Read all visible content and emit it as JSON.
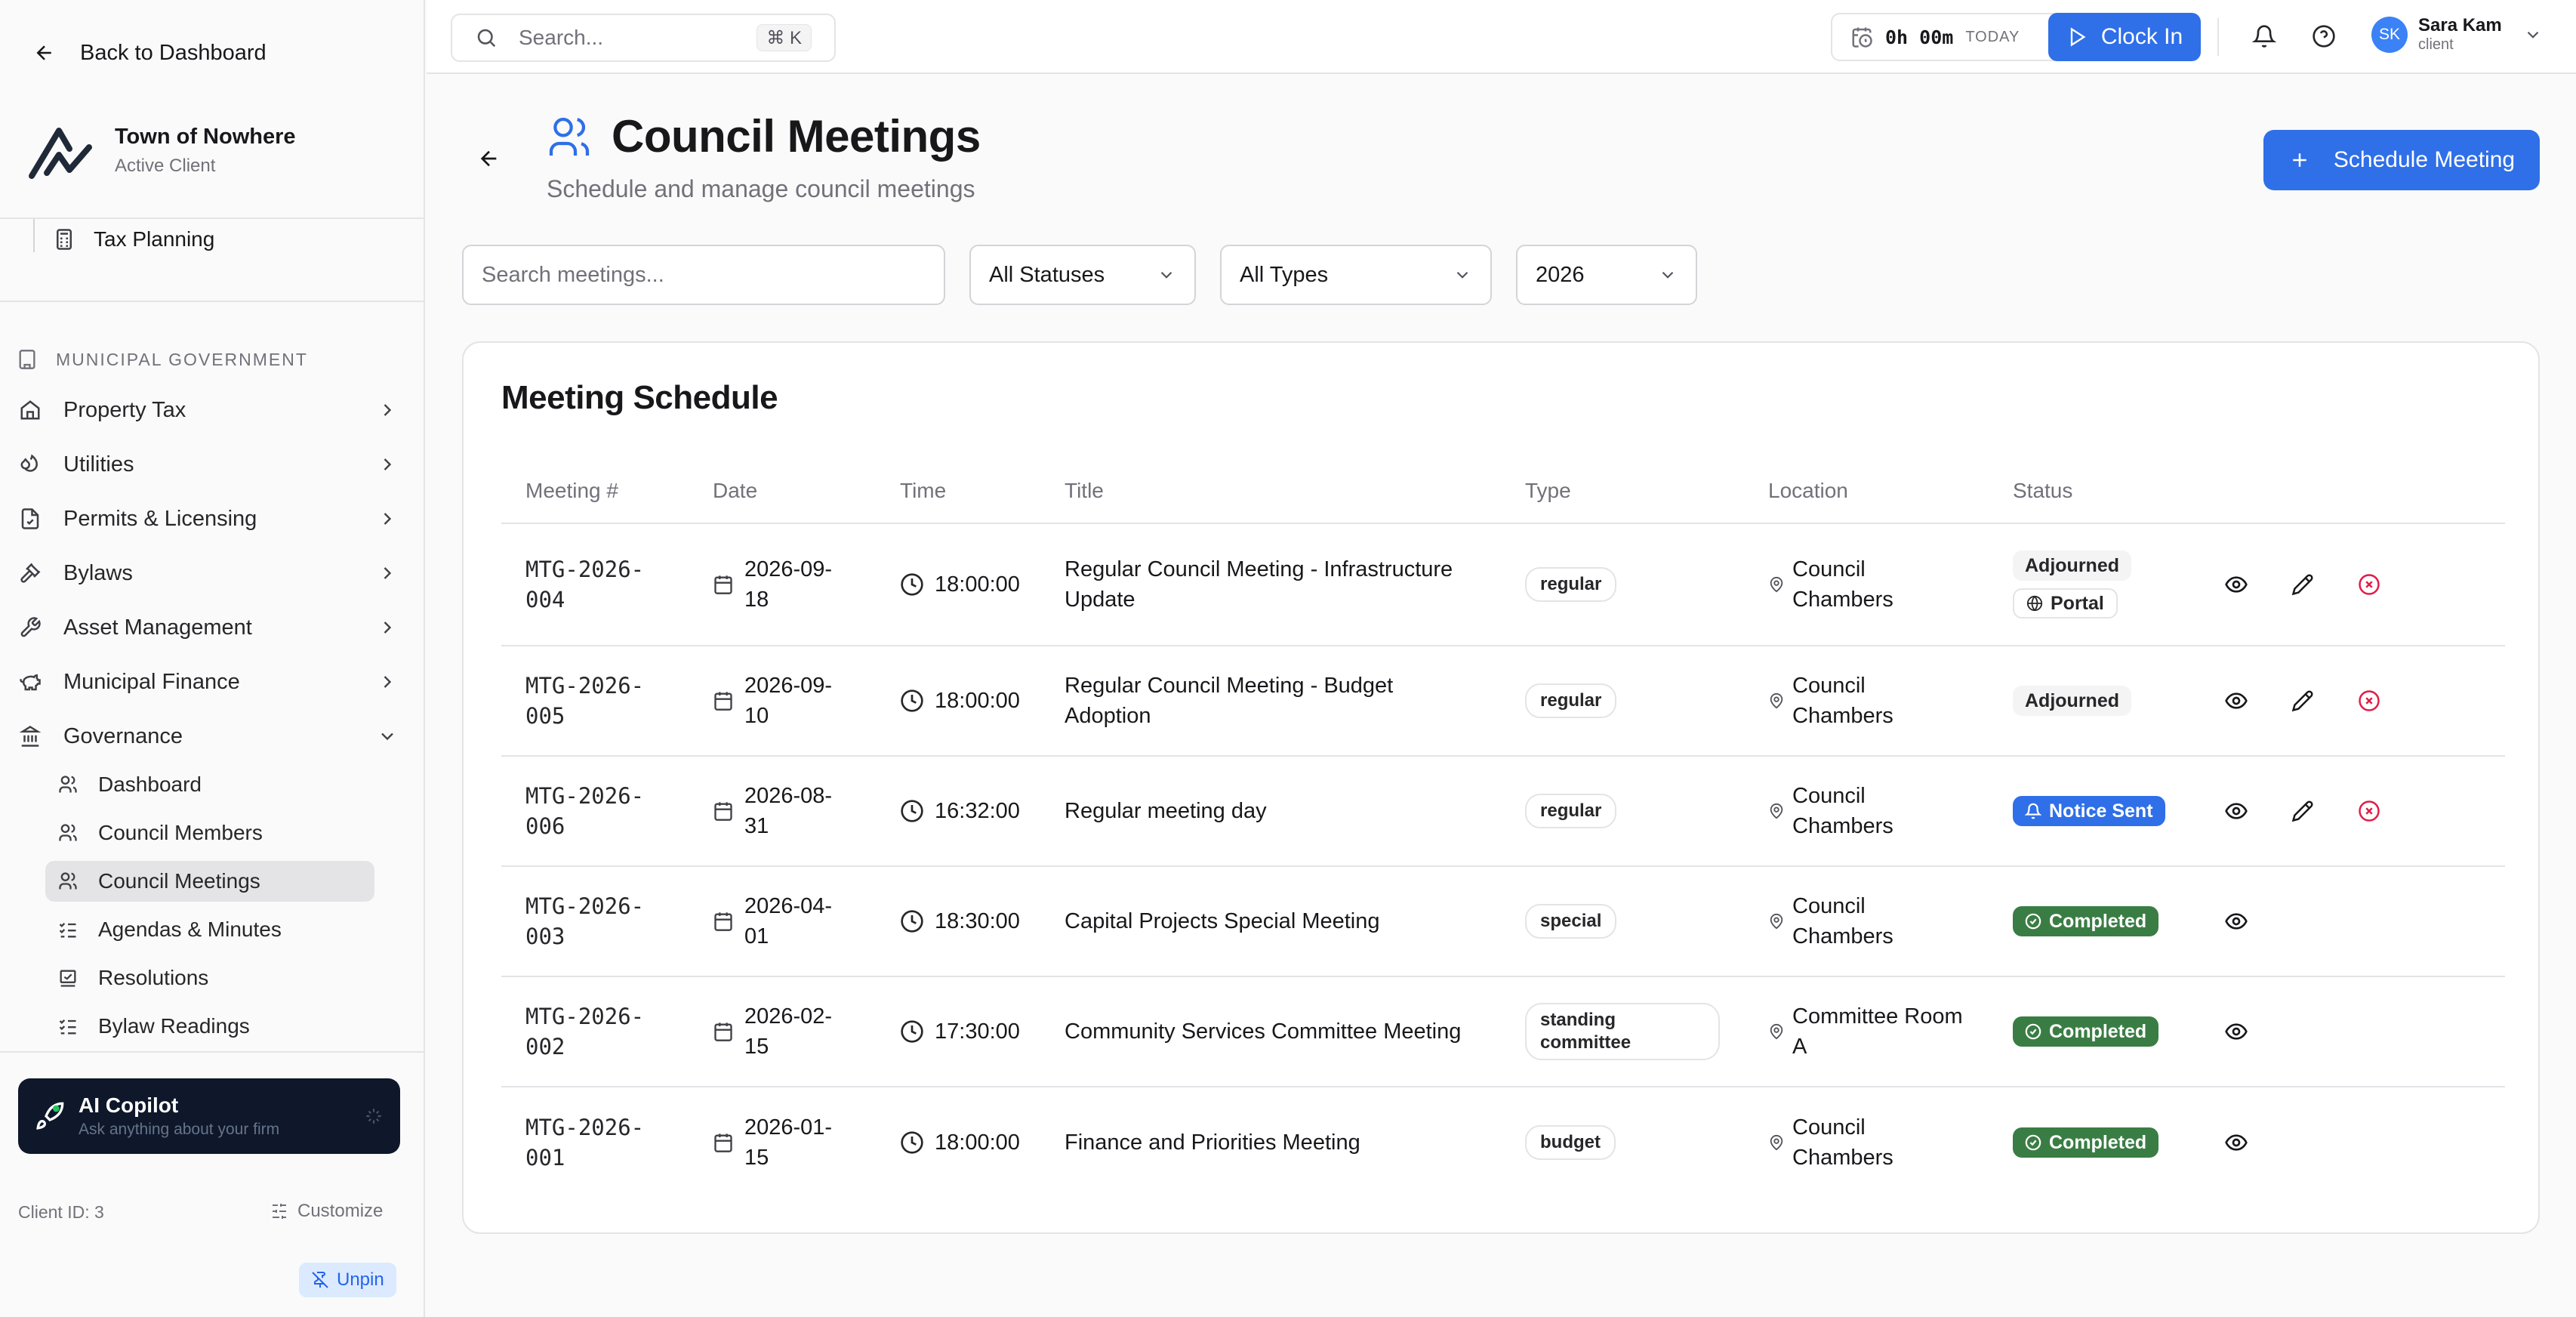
{
  "sidebar": {
    "back_label": "Back to Dashboard",
    "client_name": "Town of Nowhere",
    "client_status": "Active Client",
    "tax_planning": "Tax Planning",
    "section": "MUNICIPAL GOVERNMENT",
    "items": [
      {
        "label": "Property Tax",
        "icon": "home-icon"
      },
      {
        "label": "Utilities",
        "icon": "droplet-icon"
      },
      {
        "label": "Permits & Licensing",
        "icon": "file-check-icon"
      },
      {
        "label": "Bylaws",
        "icon": "gavel-icon"
      },
      {
        "label": "Asset Management",
        "icon": "wrench-icon"
      },
      {
        "label": "Municipal Finance",
        "icon": "piggy-bank-icon"
      },
      {
        "label": "Governance",
        "icon": "landmark-icon"
      }
    ],
    "sub_items": [
      {
        "label": "Dashboard",
        "icon": "users-icon"
      },
      {
        "label": "Council Members",
        "icon": "users-icon"
      },
      {
        "label": "Council Meetings",
        "icon": "users-icon"
      },
      {
        "label": "Agendas & Minutes",
        "icon": "list-checks-icon"
      },
      {
        "label": "Resolutions",
        "icon": "stamp-icon"
      },
      {
        "label": "Bylaw Readings",
        "icon": "list-checks-icon"
      }
    ],
    "copilot_title": "AI Copilot",
    "copilot_sub": "Ask anything about your firm",
    "client_id": "Client ID: 3",
    "customize": "Customize",
    "unpin": "Unpin"
  },
  "topbar": {
    "search_placeholder": "Search...",
    "kbd": "⌘ K",
    "timer": "0h 00m",
    "timer_label": "TODAY",
    "clock_in": "Clock In",
    "user_initials": "SK",
    "user_name": "Sara Kam",
    "user_role": "client"
  },
  "page": {
    "title": "Council Meetings",
    "subtitle": "Schedule and manage council meetings",
    "schedule_button": "Schedule Meeting"
  },
  "filters": {
    "search_placeholder": "Search meetings...",
    "status": "All Statuses",
    "type": "All Types",
    "year": "2026"
  },
  "table": {
    "title": "Meeting Schedule",
    "headers": [
      "Meeting #",
      "Date",
      "Time",
      "Title",
      "Type",
      "Location",
      "Status"
    ],
    "rows": [
      {
        "num1": "MTG-2026-",
        "num2": "004",
        "date1": "2026-09-",
        "date2": "18",
        "time": "18:00:00",
        "title1": "Regular Council Meeting - Infrastructure",
        "title2": "Update",
        "type1": "regular",
        "type2": "",
        "loc1": "Council",
        "loc2": "Chambers",
        "status": "Adjourned",
        "status2": "Portal",
        "edit": true
      },
      {
        "num1": "MTG-2026-",
        "num2": "005",
        "date1": "2026-09-",
        "date2": "10",
        "time": "18:00:00",
        "title1": "Regular Council Meeting - Budget",
        "title2": "Adoption",
        "type1": "regular",
        "type2": "",
        "loc1": "Council",
        "loc2": "Chambers",
        "status": "Adjourned",
        "status2": "",
        "edit": true
      },
      {
        "num1": "MTG-2026-",
        "num2": "006",
        "date1": "2026-08-",
        "date2": "31",
        "time": "16:32:00",
        "title1": "Regular meeting day",
        "title2": "",
        "type1": "regular",
        "type2": "",
        "loc1": "Council",
        "loc2": "Chambers",
        "status": "Notice Sent",
        "status2": "",
        "edit": true
      },
      {
        "num1": "MTG-2026-",
        "num2": "003",
        "date1": "2026-04-",
        "date2": "01",
        "time": "18:30:00",
        "title1": "Capital Projects Special Meeting",
        "title2": "",
        "type1": "special",
        "type2": "",
        "loc1": "Council",
        "loc2": "Chambers",
        "status": "Completed",
        "status2": "",
        "edit": false
      },
      {
        "num1": "MTG-2026-",
        "num2": "002",
        "date1": "2026-02-",
        "date2": "15",
        "time": "17:30:00",
        "title1": "Community Services Committee Meeting",
        "title2": "",
        "type1": "standing",
        "type2": "committee",
        "loc1": "Committee Room",
        "loc2": "A",
        "status": "Completed",
        "status2": "",
        "edit": false
      },
      {
        "num1": "MTG-2026-",
        "num2": "001",
        "date1": "2026-01-",
        "date2": "15",
        "time": "18:00:00",
        "title1": "Finance and Priorities Meeting",
        "title2": "",
        "type1": "budget",
        "type2": "",
        "loc1": "Council",
        "loc2": "Chambers",
        "status": "Completed",
        "status2": "",
        "edit": false
      }
    ]
  },
  "colors": {
    "primary": "#2f6fe8",
    "completed": "#3a7d44",
    "danger": "#e11d48"
  }
}
